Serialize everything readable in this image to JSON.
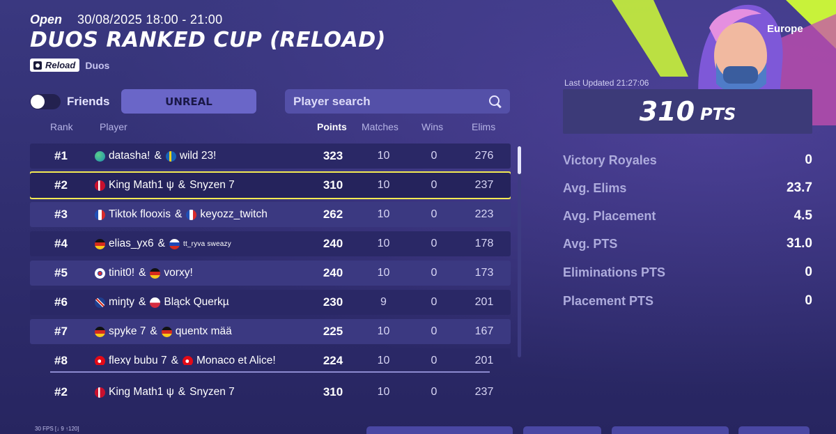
{
  "header": {
    "status": "Open",
    "datetime": "30/08/2025 18:00 - 21:00",
    "title": "DUOS RANKED CUP (RELOAD)",
    "badge": "Reload",
    "mode": "Duos"
  },
  "filters": {
    "friends_label": "Friends",
    "friends_on": false,
    "division_label": "UNREAL",
    "search_placeholder": "Player search"
  },
  "table": {
    "columns": {
      "rank": "Rank",
      "player": "Player",
      "points": "Points",
      "matches": "Matches",
      "wins": "Wins",
      "elims": "Elims"
    },
    "rows": [
      {
        "rank": "#1",
        "p1": "datasha!",
        "p1_flag": "globe",
        "p2": "wild 23!",
        "p2_flag": "sweden",
        "points": "323",
        "matches": "10",
        "wins": "0",
        "elims": "276"
      },
      {
        "rank": "#2",
        "p1": "King Math1 ψ",
        "p1_flag": "denmark",
        "p2": "Snyzen 7",
        "p2_flag": "",
        "points": "310",
        "matches": "10",
        "wins": "0",
        "elims": "237"
      },
      {
        "rank": "#3",
        "p1": "Tiktok flooxis",
        "p1_flag": "france",
        "p2": "keyozz_twitch",
        "p2_flag": "france",
        "points": "262",
        "matches": "10",
        "wins": "0",
        "elims": "223"
      },
      {
        "rank": "#4",
        "p1": "elias_yx6",
        "p1_flag": "germany",
        "p2": "tt_ryva sweazy",
        "p2_flag": "russia",
        "points": "240",
        "matches": "10",
        "wins": "0",
        "elims": "178"
      },
      {
        "rank": "#5",
        "p1": "tinit0!",
        "p1_flag": "south-korea",
        "p2": "vorxy!",
        "p2_flag": "germany",
        "points": "240",
        "matches": "10",
        "wins": "0",
        "elims": "173"
      },
      {
        "rank": "#6",
        "p1": "miŋty",
        "p1_flag": "uk",
        "p2": "Bląck Querkµ",
        "p2_flag": "poland",
        "points": "230",
        "matches": "9",
        "wins": "0",
        "elims": "201"
      },
      {
        "rank": "#7",
        "p1": "spyke 7",
        "p1_flag": "germany",
        "p2": "quentx mää",
        "p2_flag": "germany",
        "points": "225",
        "matches": "10",
        "wins": "0",
        "elims": "167"
      },
      {
        "rank": "#8",
        "p1": "flexy bubu 7",
        "p1_flag": "turkey",
        "p2": "Monaco et Alice!",
        "p2_flag": "turkey",
        "points": "224",
        "matches": "10",
        "wins": "0",
        "elims": "201"
      }
    ],
    "pinned": {
      "rank": "#2",
      "p1": "King Math1 ψ",
      "p1_flag": "denmark",
      "p2": "Snyzen 7",
      "p2_flag": "",
      "points": "310",
      "matches": "10",
      "wins": "0",
      "elims": "237"
    }
  },
  "panel": {
    "region": "Europe",
    "last_updated": "Last Updated 21:27:06",
    "points_value": "310",
    "points_unit": "PTS",
    "stats": [
      {
        "label": "Victory Royales",
        "value": "0"
      },
      {
        "label": "Avg. Elims",
        "value": "23.7"
      },
      {
        "label": "Avg. Placement",
        "value": "4.5"
      },
      {
        "label": "Avg. PTS",
        "value": "31.0"
      },
      {
        "label": "Eliminations PTS",
        "value": "0"
      },
      {
        "label": "Placement PTS",
        "value": "0"
      }
    ]
  },
  "footer": {
    "fps": "30 FPS [↓ 9 ↑120]"
  },
  "colors": {
    "highlight": "#f3ea52",
    "accent": "#6a66c8",
    "background": "#3a3880"
  }
}
